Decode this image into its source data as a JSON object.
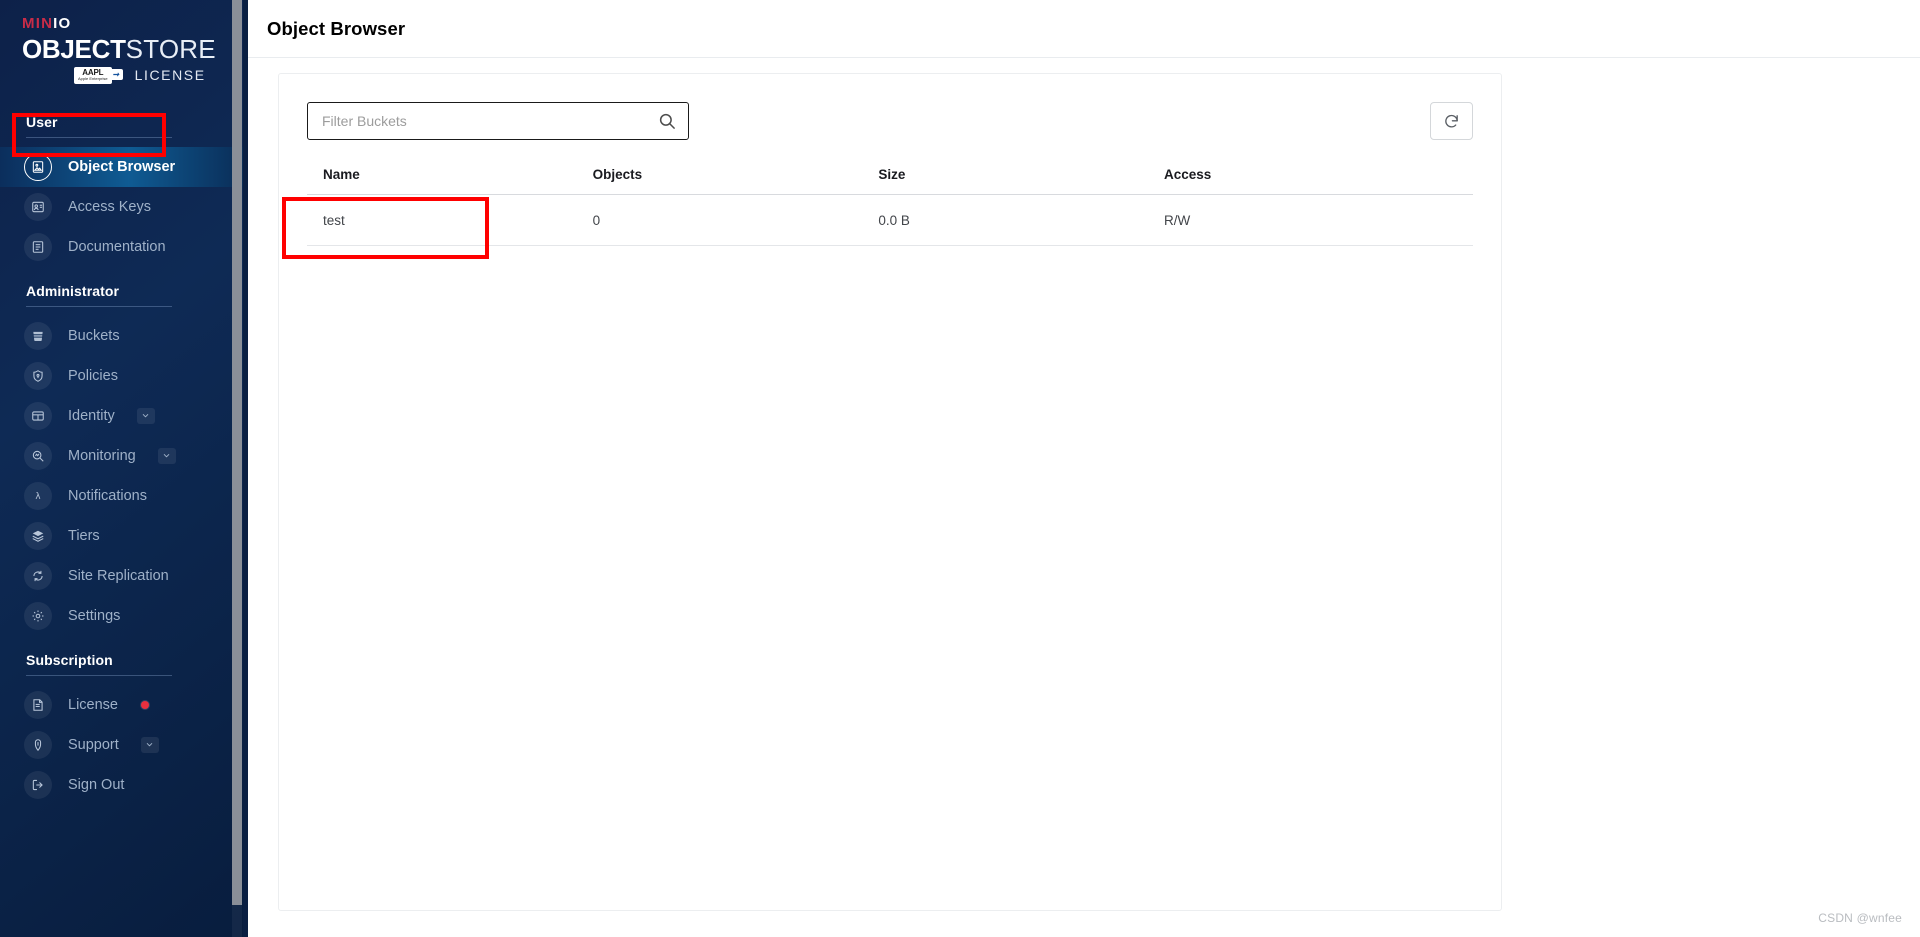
{
  "brand": {
    "minio_min": "MIN",
    "minio_io": "IO",
    "object": "OBJECT",
    "store": "STORE",
    "aapl_main": "AAPL",
    "aapl_sub": "Apple Enterprise",
    "license": "LICENSE"
  },
  "sidebar": {
    "sections": [
      {
        "title": "User",
        "items": [
          {
            "label": "Object Browser",
            "icon": "object-browser-icon",
            "active": true
          },
          {
            "label": "Access Keys",
            "icon": "access-keys-icon",
            "active": false
          },
          {
            "label": "Documentation",
            "icon": "documentation-icon",
            "active": false
          }
        ]
      },
      {
        "title": "Administrator",
        "items": [
          {
            "label": "Buckets",
            "icon": "bucket-icon",
            "active": false
          },
          {
            "label": "Policies",
            "icon": "policy-icon",
            "active": false
          },
          {
            "label": "Identity",
            "icon": "identity-icon",
            "active": false,
            "expandable": true
          },
          {
            "label": "Monitoring",
            "icon": "monitoring-icon",
            "active": false,
            "expandable": true
          },
          {
            "label": "Notifications",
            "icon": "lambda-icon",
            "active": false
          },
          {
            "label": "Tiers",
            "icon": "tiers-icon",
            "active": false
          },
          {
            "label": "Site Replication",
            "icon": "replication-icon",
            "active": false
          },
          {
            "label": "Settings",
            "icon": "gear-icon",
            "active": false
          }
        ]
      },
      {
        "title": "Subscription",
        "items": [
          {
            "label": "License",
            "icon": "license-icon",
            "active": false,
            "badge_dot": true
          },
          {
            "label": "Support",
            "icon": "support-icon",
            "active": false,
            "expandable": true
          },
          {
            "label": "Sign Out",
            "icon": "sign-out-icon",
            "active": false
          }
        ]
      }
    ]
  },
  "header": {
    "title": "Object Browser"
  },
  "toolbar": {
    "filter_placeholder": "Filter Buckets",
    "filter_value": "",
    "search_icon": "search-icon",
    "refresh_icon": "refresh-icon",
    "refresh_label": "Refresh"
  },
  "table": {
    "columns": [
      "Name",
      "Objects",
      "Size",
      "Access"
    ],
    "rows": [
      {
        "name": "test",
        "objects": "0",
        "size": "0.0 B",
        "access": "R/W"
      }
    ]
  },
  "watermark": {
    "text": "CSDN @wnfee"
  }
}
